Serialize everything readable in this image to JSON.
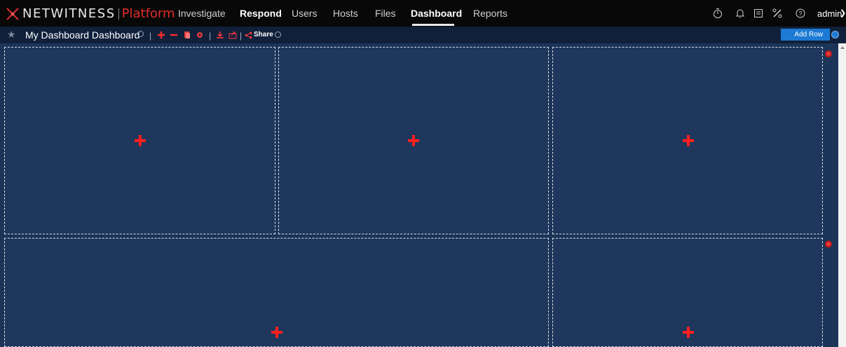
{
  "header": {
    "brand": "NETWITNESS",
    "brand_sub": "Platform",
    "nav": [
      "Investigate",
      "Respond",
      "Users",
      "Hosts",
      "Files",
      "Dashboard",
      "Reports"
    ],
    "active_nav": "Dashboard",
    "user": "admin"
  },
  "toolbar": {
    "title": "My Dashboard Dashboard",
    "share_label": "Share",
    "add_row_label": "Add Row"
  },
  "icons": {
    "timer": "timer-icon",
    "bell": "bell-icon",
    "tasks": "tasks-icon",
    "tools": "tools-icon",
    "help": "help-icon"
  },
  "colors": {
    "brand_accent": "#e22d2d",
    "canvas": "#1c3458",
    "button": "#1d7ad4"
  }
}
